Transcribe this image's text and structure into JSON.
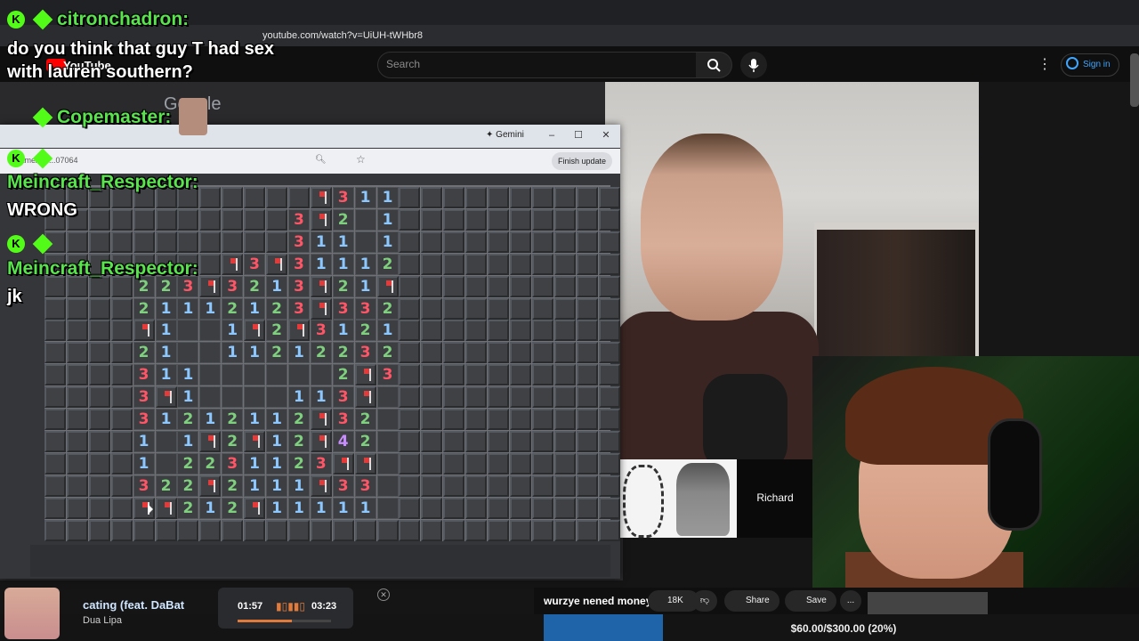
{
  "browser": {
    "url": "youtube.com/watch?v=UiUH-tWHbr8"
  },
  "youtube": {
    "logo_text": "YouTube",
    "search_placeholder": "Search",
    "signin_label": "Sign in",
    "song_title": "wurzye nened money",
    "likes": "18K",
    "share_label": "Share",
    "save_label": "Save",
    "more_label": "...",
    "card_name": "Richard"
  },
  "google_text": "Google",
  "gemini_window": {
    "title": "Gemini",
    "url": "...game/54 ...07064",
    "finish_update_label": "Finish update",
    "minimize": "–",
    "maximize": "☐",
    "close": "✕"
  },
  "minesweeper": {
    "cols": 26,
    "rows": 16,
    "revealed_rows": [
      {
        "row": 0,
        "start": 12,
        "cells": [
          "F",
          "3",
          "1",
          "1"
        ]
      },
      {
        "row": 1,
        "start": 11,
        "cells": [
          "3",
          "F",
          "2",
          "",
          "1"
        ]
      },
      {
        "row": 2,
        "start": 11,
        "cells": [
          "3",
          "1",
          "1",
          "",
          "1"
        ]
      },
      {
        "row": 3,
        "start": 8,
        "cells": [
          "F",
          "3",
          "F",
          "3",
          "1",
          "1",
          "1",
          "2"
        ]
      },
      {
        "row": 4,
        "start": 4,
        "cells": [
          "2",
          "2",
          "3",
          "F",
          "3",
          "2",
          "1",
          "3",
          "F",
          "2",
          "1",
          "F"
        ]
      },
      {
        "row": 5,
        "start": 4,
        "cells": [
          "2",
          "1",
          "1",
          "1",
          "2",
          "1",
          "2",
          "3",
          "F",
          "3",
          "3",
          "2"
        ]
      },
      {
        "row": 6,
        "start": 4,
        "cells": [
          "F",
          "1",
          "",
          "",
          "1",
          "F",
          "2",
          "F",
          "3",
          "1",
          "2",
          "1"
        ]
      },
      {
        "row": 7,
        "start": 4,
        "cells": [
          "2",
          "1",
          "",
          "",
          "1",
          "1",
          "2",
          "1",
          "2",
          "2",
          "3",
          "2"
        ]
      },
      {
        "row": 8,
        "start": 4,
        "cells": [
          "3",
          "1",
          "1",
          "",
          "",
          "",
          "",
          "",
          "",
          "2",
          "F",
          "3"
        ]
      },
      {
        "row": 9,
        "start": 4,
        "cells": [
          "3",
          "F",
          "1",
          "",
          "",
          "",
          "",
          "1",
          "1",
          "3",
          "F",
          ""
        ]
      },
      {
        "row": 10,
        "start": 4,
        "cells": [
          "3",
          "1",
          "2",
          "1",
          "2",
          "1",
          "1",
          "2",
          "F",
          "3",
          "2",
          ""
        ]
      },
      {
        "row": 11,
        "start": 4,
        "cells": [
          "1",
          "",
          "1",
          "F",
          "2",
          "F",
          "1",
          "2",
          "F",
          "4",
          "2",
          ""
        ]
      },
      {
        "row": 12,
        "start": 4,
        "cells": [
          "1",
          "",
          "2",
          "2",
          "3",
          "1",
          "1",
          "2",
          "3",
          "F",
          "F",
          ""
        ]
      },
      {
        "row": 13,
        "start": 4,
        "cells": [
          "3",
          "2",
          "2",
          "F",
          "2",
          "1",
          "1",
          "1",
          "F",
          "3",
          "3",
          ""
        ]
      },
      {
        "row": 14,
        "start": 4,
        "cells": [
          "F",
          "F",
          "2",
          "1",
          "2",
          "F",
          "1",
          "1",
          "1",
          "1",
          "1",
          ""
        ]
      }
    ],
    "number_colors": {
      "1": "#8cc8ff",
      "2": "#7fd07e",
      "3": "#ff5566",
      "4": "#c88cff"
    }
  },
  "chat": [
    {
      "user": "citronchadron:",
      "message": "do you think that guy T had sex\nwith lauren southern?"
    },
    {
      "user": "Copemaster:",
      "message": ""
    },
    {
      "user": "Meincraft_Respector:",
      "message": "WRONG"
    },
    {
      "user": "Meincraft_Respector:",
      "message": "jk"
    }
  ],
  "music": {
    "song": "cating (feat. DaBat",
    "artist": "Dua Lipa",
    "current_time": "01:57",
    "total_time": "03:23",
    "progress_fraction": 0.58
  },
  "goal": {
    "text": "$60.00/$300.00 (20%)"
  },
  "colors": {
    "chat_username": "#59e34d",
    "kick_badge": "#53fc18",
    "youtube_link_blue": "#3ea6ff"
  }
}
